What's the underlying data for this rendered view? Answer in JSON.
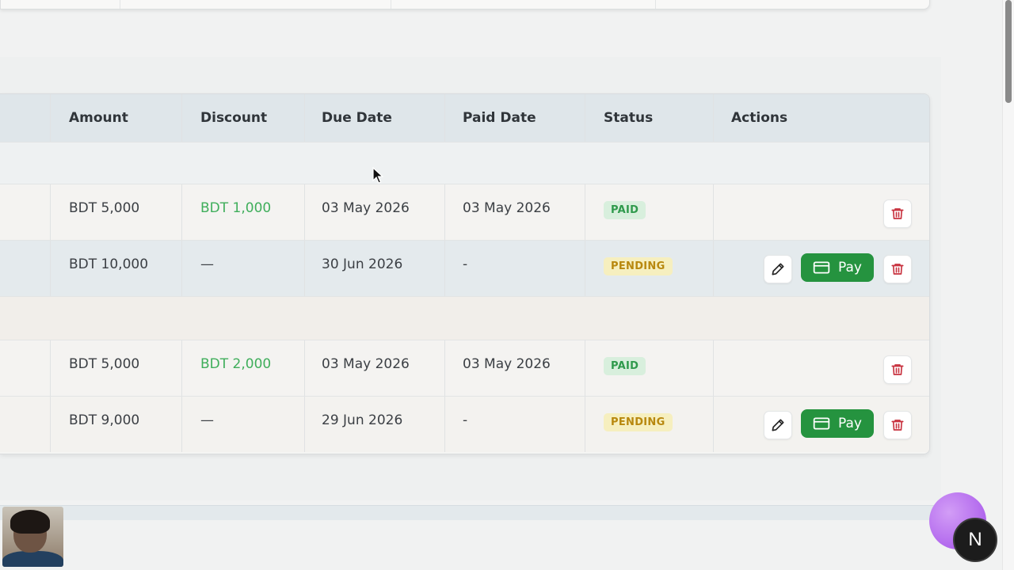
{
  "table": {
    "columns": {
      "amount": "Amount",
      "discount": "Discount",
      "due_date": "Due Date",
      "paid_date": "Paid Date",
      "status": "Status",
      "actions": "Actions"
    },
    "rows": [
      {
        "amount": "BDT 5,000",
        "discount": "BDT 1,000",
        "due_date": "03 May 2026",
        "paid_date": "03 May 2026",
        "status": "PAID"
      },
      {
        "amount": "BDT 10,000",
        "discount": "—",
        "due_date": "30 Jun 2026",
        "paid_date": "-",
        "status": "PENDING",
        "pay_label": "Pay"
      },
      {
        "amount": "BDT 5,000",
        "discount": "BDT 2,000",
        "due_date": "03 May 2026",
        "paid_date": "03 May 2026",
        "status": "PAID"
      },
      {
        "amount": "BDT 9,000",
        "discount": "—",
        "due_date": "29 Jun 2026",
        "paid_date": "-",
        "status": "PENDING",
        "pay_label": "Pay"
      }
    ]
  },
  "fab_letter": "N",
  "colors": {
    "pay_button": "#25933f",
    "delete_icon": "#c8323f",
    "paid_badge_bg": "#d8efdd",
    "pending_badge_bg": "#f6efbf",
    "discount_text": "#3fae5b"
  },
  "icons": [
    "pencil-icon",
    "card-icon",
    "trash-icon",
    "cursor-icon"
  ]
}
